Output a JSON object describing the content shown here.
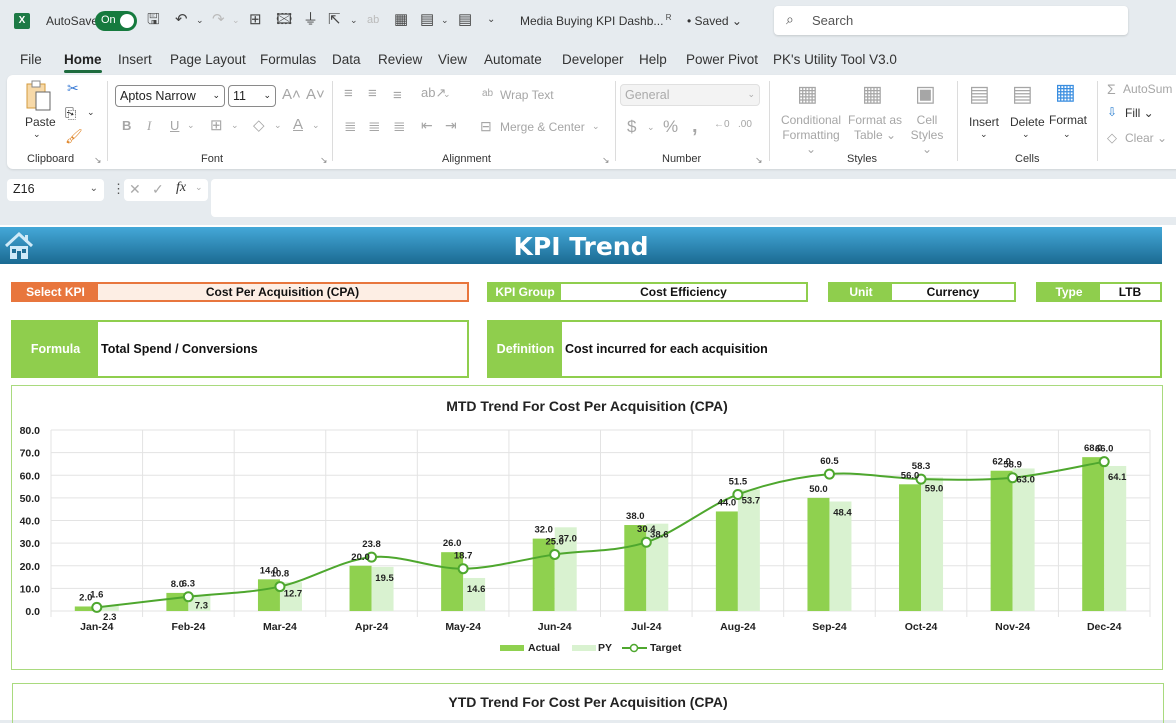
{
  "titlebar": {
    "app_icon": "excel-logo-icon",
    "app_letter": "X",
    "autosave_label": "AutoSave",
    "autosave_state": "On",
    "doc_title": "Media Buying KPI Dashb...",
    "saved_status": "• Saved ⌄",
    "search_placeholder": "Search"
  },
  "menu": {
    "tabs": [
      "File",
      "Home",
      "Insert",
      "Page Layout",
      "Formulas",
      "Data",
      "Review",
      "View",
      "Automate",
      "Developer",
      "Help",
      "Power Pivot",
      "PK's Utility Tool V3.0"
    ],
    "active": "Home"
  },
  "ribbon": {
    "clipboard": {
      "label": "Clipboard",
      "paste": "Paste"
    },
    "font": {
      "label": "Font",
      "font_name": "Aptos Narrow",
      "font_size": "11"
    },
    "alignment": {
      "label": "Alignment",
      "wrap_text": "Wrap Text",
      "merge_center": "Merge & Center"
    },
    "number": {
      "label": "Number",
      "format": "General"
    },
    "styles": {
      "label": "Styles",
      "conditional_1": "Conditional",
      "conditional_2": "Formatting ⌄",
      "format_table_1": "Format as",
      "format_table_2": "Table ⌄",
      "cell_styles_1": "Cell",
      "cell_styles_2": "Styles ⌄"
    },
    "cells": {
      "label": "Cells",
      "insert": "Insert",
      "delete": "Delete",
      "format": "Format"
    },
    "editing": {
      "autosum": "AutoSum",
      "fill": "Fill ⌄",
      "clear": "Clear ⌄"
    }
  },
  "formula_bar": {
    "name_box": "Z16",
    "formula": ""
  },
  "sheet": {
    "banner_title": "KPI Trend",
    "select_kpi": {
      "label": "Select KPI",
      "value": "Cost Per Acquisition (CPA)"
    },
    "kpi_group": {
      "label": "KPI Group",
      "value": "Cost Efficiency"
    },
    "unit": {
      "label": "Unit",
      "value": "Currency"
    },
    "type": {
      "label": "Type",
      "value": "LTB"
    },
    "formula": {
      "label": "Formula",
      "value": "Total Spend / Conversions"
    },
    "definition": {
      "label": "Definition",
      "value": "Cost incurred for each acquisition"
    },
    "ytd_title": "YTD Trend For Cost Per Acquisition (CPA)"
  },
  "colors": {
    "actual": "#8fd14f",
    "py": "#d9f2d0",
    "target": "#4ea72e",
    "accent_orange": "#e8763d",
    "accent_green": "#8fce4d",
    "banner_top": "#44a8d8",
    "banner_bottom": "#1b6a92"
  },
  "chart_data": {
    "type": "bar",
    "title": "MTD Trend For Cost Per Acquisition (CPA)",
    "xlabel": "",
    "ylabel": "",
    "categories": [
      "Jan-24",
      "Feb-24",
      "Mar-24",
      "Apr-24",
      "May-24",
      "Jun-24",
      "Jul-24",
      "Aug-24",
      "Sep-24",
      "Oct-24",
      "Nov-24",
      "Dec-24"
    ],
    "series": [
      {
        "name": "Actual",
        "type": "bar",
        "values": [
          2.0,
          8.0,
          14.0,
          20.0,
          26.0,
          32.0,
          38.0,
          44.0,
          50.0,
          56.0,
          62.0,
          68.0
        ]
      },
      {
        "name": "PY",
        "type": "bar",
        "values": [
          2.3,
          7.3,
          12.7,
          19.5,
          14.6,
          37.0,
          38.6,
          53.7,
          48.4,
          59.0,
          63.0,
          64.1
        ]
      },
      {
        "name": "Target",
        "type": "line",
        "values": [
          1.6,
          6.3,
          10.8,
          23.8,
          18.7,
          25.0,
          30.4,
          51.5,
          60.5,
          58.3,
          58.9,
          66.0
        ]
      }
    ],
    "ylim": [
      0,
      80
    ],
    "yticks": [
      "0.0",
      "10.0",
      "20.0",
      "30.0",
      "40.0",
      "50.0",
      "60.0",
      "70.0",
      "80.0"
    ],
    "grid": true,
    "legend": "bottom"
  }
}
